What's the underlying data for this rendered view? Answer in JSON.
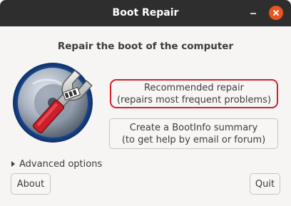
{
  "window": {
    "title": "Boot Repair"
  },
  "main": {
    "heading": "Repair the boot of the computer",
    "recommended": {
      "line1": "Recommended repair",
      "line2": "(repairs most frequent problems)"
    },
    "bootinfo": {
      "line1": "Create a BootInfo summary",
      "line2": "(to get help by email or forum)"
    },
    "advanced_label": "Advanced options"
  },
  "footer": {
    "about_label": "About",
    "quit_label": "Quit"
  },
  "colors": {
    "titlebar": "#2e2e2e",
    "close": "#e95420",
    "highlight": "#d11f2a"
  }
}
